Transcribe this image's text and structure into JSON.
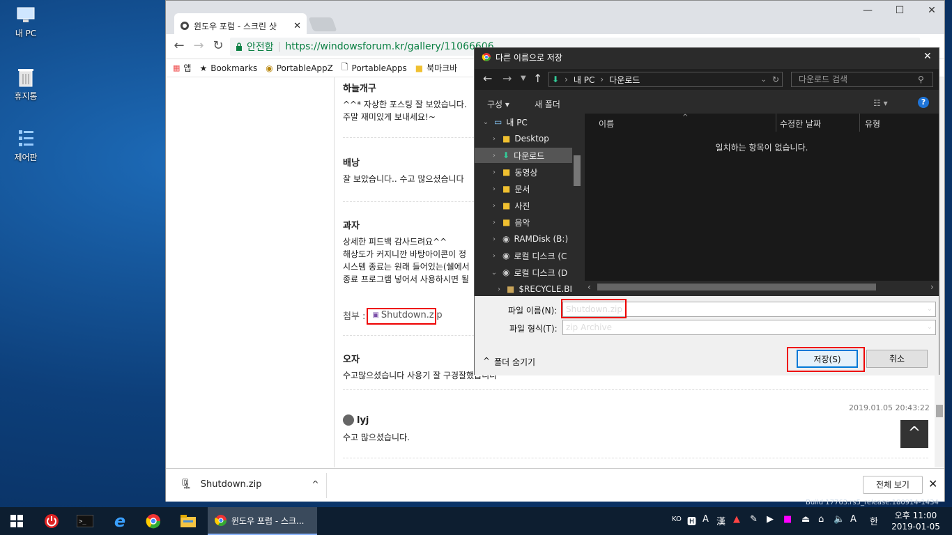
{
  "desktop": {
    "icons": [
      {
        "label": "내 PC",
        "icon": "computer-icon"
      },
      {
        "label": "휴지통",
        "icon": "recycle-bin-icon"
      },
      {
        "label": "제어판",
        "icon": "control-panel-icon"
      }
    ]
  },
  "browser": {
    "tab_title": "윈도우 포럼 - 스크린 샷",
    "secure_label": "안전함",
    "url": "https://windowsforum.kr/gallery/11066606",
    "bookmarks": [
      "앱",
      "Bookmarks",
      "PortableAppZ",
      "PortableApps",
      "북마크바"
    ],
    "comments": [
      {
        "name": "하늘개구",
        "lines": [
          "^^* 자상한 포스팅 잘 보았습니다.",
          "주말 재미있게 보내세요!~"
        ]
      },
      {
        "name": "배낭",
        "lines": [
          "잘 보았습니다.. 수고 많으셨습니다"
        ]
      },
      {
        "name": "과자",
        "lines": [
          "상세한 피드백 감사드려요^^",
          "해상도가 커지니깐 바탕아이콘이 정",
          "시스템 종료는 원래 들어있는(쉘에서",
          "종료 프로그램 넣어서 사용하시면 될"
        ]
      },
      {
        "name": "오자",
        "lines": [
          "수고많으셨습니다 사용기 잘 구경잘했습니다"
        ]
      },
      {
        "name": "lyj",
        "lines": [
          "수고 많으셨습니다."
        ],
        "date": "2019.01.05  20:43:22"
      }
    ],
    "attach_label": "첨부 :",
    "attach_file": "Shutdown.zip",
    "download": {
      "file": "Shutdown.zip",
      "show_all": "전체 보기"
    }
  },
  "dialog": {
    "title": "다른 이름으로 저장",
    "path": [
      "내 PC",
      "다운로드"
    ],
    "search_placeholder": "다운로드 검색",
    "organize": "구성",
    "new_folder": "새 폴더",
    "nav": [
      {
        "label": "내 PC",
        "icon": "computer-icon",
        "expanded": true
      },
      {
        "label": "Desktop",
        "icon": "desktop-folder-icon"
      },
      {
        "label": "다운로드",
        "icon": "download-folder-icon",
        "selected": true
      },
      {
        "label": "동영상",
        "icon": "video-folder-icon"
      },
      {
        "label": "문서",
        "icon": "documents-folder-icon"
      },
      {
        "label": "사진",
        "icon": "pictures-folder-icon"
      },
      {
        "label": "음악",
        "icon": "music-folder-icon"
      },
      {
        "label": "RAMDisk (B:)",
        "icon": "drive-icon"
      },
      {
        "label": "로컬 디스크 (C",
        "icon": "drive-icon"
      },
      {
        "label": "로컬 디스크 (D",
        "icon": "drive-icon",
        "expanded": true
      },
      {
        "label": "$RECYCLE.BI",
        "icon": "folder-icon"
      }
    ],
    "columns": [
      "이름",
      "수정한 날짜",
      "유형"
    ],
    "empty_message": "일치하는 항목이 없습니다.",
    "filename_label": "파일 이름(N):",
    "filename": "Shutdown.zip",
    "filetype_label": "파일 형식(T):",
    "filetype": "zip Archive",
    "hide_folders": "폴더 숨기기",
    "save": "저장(S)",
    "cancel": "취소"
  },
  "taskbar": {
    "task_label": "윈도우 포럼 - 스크...",
    "ime": "KO",
    "time": "오후 11:00",
    "date": "2019-01-05",
    "lang": "한",
    "build_text": "Build 17763.rs5_release.180914-1434"
  }
}
